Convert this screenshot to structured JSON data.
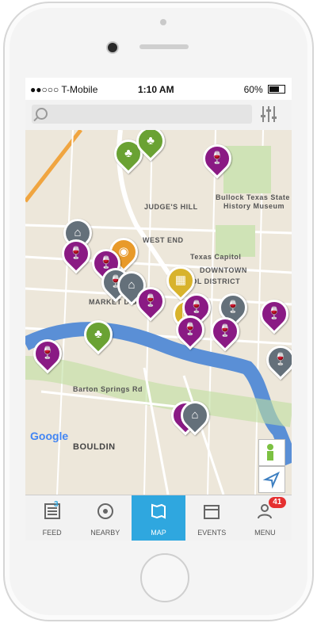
{
  "status_bar": {
    "carrier": "●●○○○ T-Mobile",
    "time": "1:10 AM",
    "battery": "60%"
  },
  "search": {
    "placeholder": ""
  },
  "map": {
    "labels": {
      "bullock_museum": "Bullock Texas State",
      "bullock_museum_2": "History Museum",
      "judges_hill": "JUDGE'S HILL",
      "west_end": "WEST END",
      "texas_capitol": "Texas Capitol",
      "downtown": "DOWNTOWN",
      "capitol_district": "CAPITOL DISTRICT",
      "market_district": "MARKET DISTRICT",
      "barton_springs": "Barton Springs Rd",
      "bouldin": "BOULDIN",
      "google": "Google"
    },
    "zoom_label": "+"
  },
  "tabs": [
    {
      "label": "FEED",
      "badge": "3"
    },
    {
      "label": "NEARBY"
    },
    {
      "label": "MAP"
    },
    {
      "label": "EVENTS"
    },
    {
      "label": "MENU",
      "badge": "41"
    }
  ],
  "icons": {
    "wine": "🍷",
    "home": "⌂",
    "bag": "◉",
    "building": "▦",
    "tree": "♣"
  }
}
